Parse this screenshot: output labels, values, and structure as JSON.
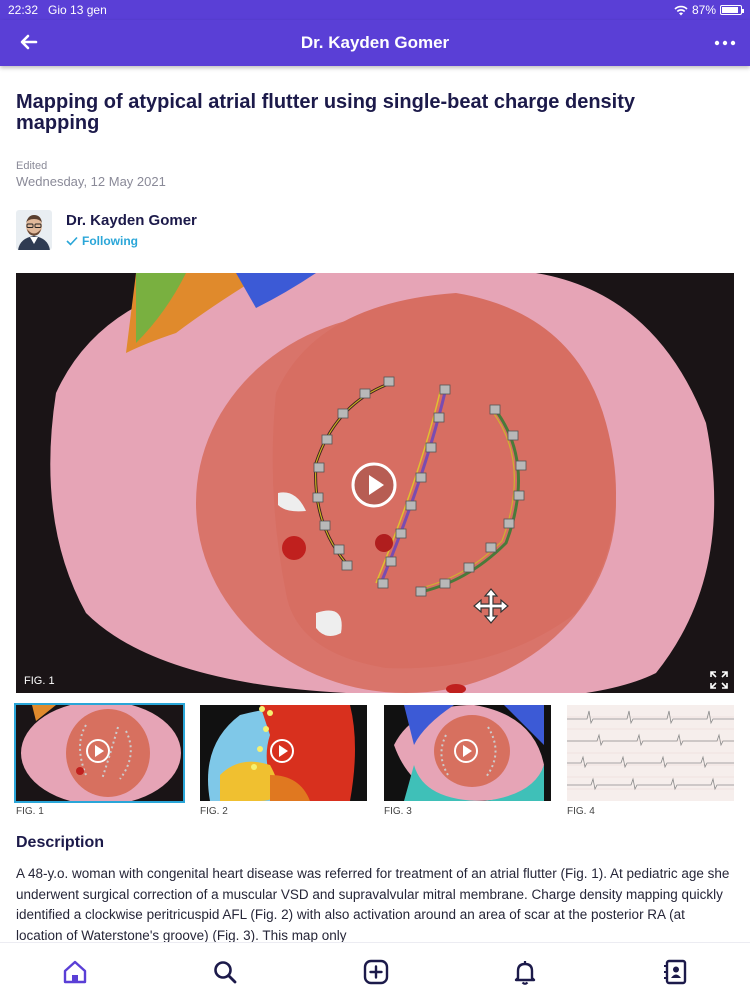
{
  "status_bar": {
    "time": "22:32",
    "date": "Gio 13 gen",
    "battery": "87%",
    "battery_level": 0.87
  },
  "header": {
    "title": "Dr. Kayden Gomer"
  },
  "post": {
    "title": "Mapping of atypical atrial flutter using single-beat charge density mapping",
    "edited_label": "Edited",
    "edited_date": "Wednesday, 12 May 2021",
    "author": {
      "name": "Dr. Kayden Gomer",
      "follow_status": "Following"
    },
    "main_figure_label": "FIG. 1",
    "figures": [
      {
        "label": "FIG. 1",
        "has_video": true
      },
      {
        "label": "FIG. 2",
        "has_video": true
      },
      {
        "label": "FIG. 3",
        "has_video": true
      },
      {
        "label": "FIG. 4",
        "has_video": false
      }
    ],
    "description_heading": "Description",
    "description": "A 48-y.o. woman with congenital heart disease was referred for treatment of an atrial flutter (Fig. 1). At pediatric age she underwent surgical correction of a muscular VSD and supravalvular mitral membrane. Charge density mapping quickly identified a clockwise peritricuspid AFL (Fig. 2) with also activation around an area of scar at the posterior RA (at location of Waterstone's groove) (Fig. 3). This map only"
  },
  "tabs": [
    "home-icon",
    "search-icon",
    "add-icon",
    "bell-icon",
    "contacts-icon"
  ],
  "colors": {
    "header": "#5a3fd6",
    "accent": "#2aa6d8",
    "title": "#1c1a4a"
  }
}
